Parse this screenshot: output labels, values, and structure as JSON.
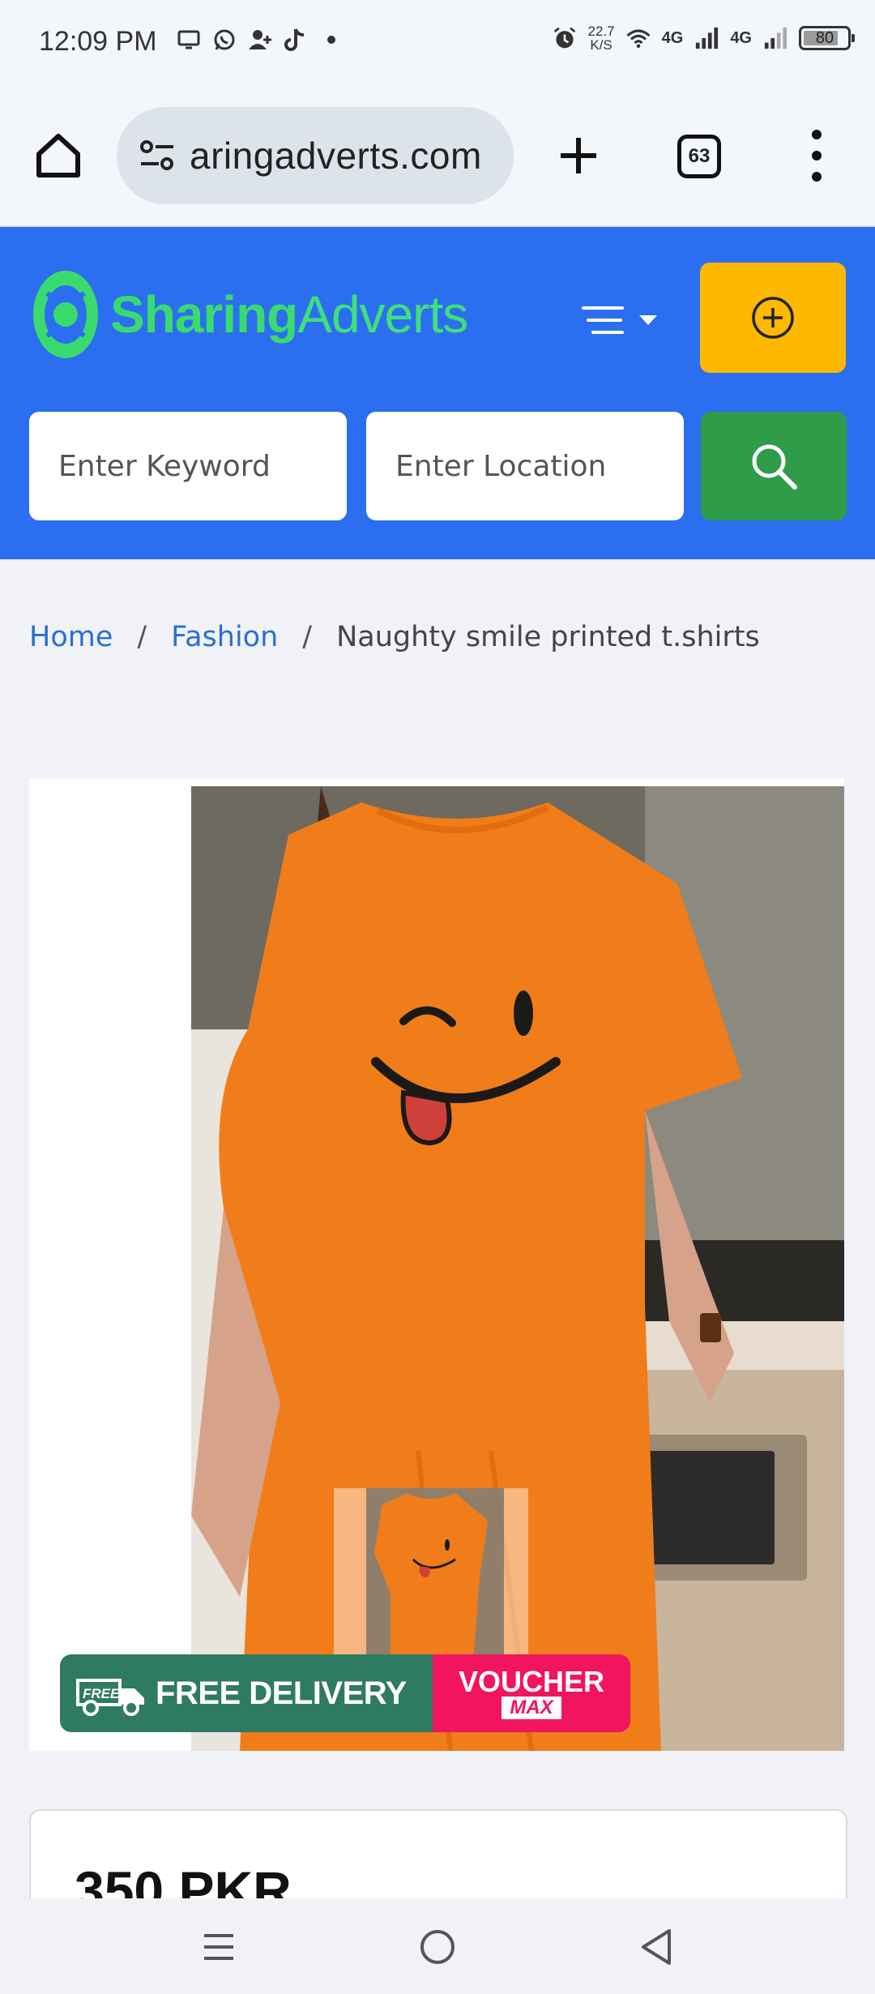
{
  "status_bar": {
    "time": "12:09 PM",
    "speed_value": "22.7",
    "speed_unit": "K/S",
    "network_1": "4G",
    "network_2": "4G",
    "battery": "80",
    "battery_level_percent": 80,
    "icons": [
      "screen-icon",
      "whatsapp-icon",
      "contact-add-icon",
      "tiktok-icon",
      "dot-icon",
      "alarm-icon",
      "wifi-icon",
      "signal-icon",
      "signal-icon",
      "battery-icon"
    ]
  },
  "browser": {
    "url": "aringadverts.com",
    "tab_count": "63",
    "icons": [
      "home-icon",
      "site-settings-icon",
      "plus-icon",
      "tabs-icon",
      "more-vert-icon"
    ]
  },
  "header": {
    "logo_bold": "Sharing",
    "logo_light": "Adverts",
    "brand_color": "#2b6ff0",
    "logo_color": "#3adb6e",
    "post_ad_color": "#ffb800",
    "search": {
      "keyword_placeholder": "Enter Keyword",
      "location_placeholder": "Enter Location",
      "button_color": "#2e9c48"
    }
  },
  "breadcrumb": {
    "items": [
      {
        "label": "Home"
      },
      {
        "label": "Fashion"
      }
    ],
    "separator": "/",
    "current": "Naughty smile printed t.shirts"
  },
  "gallery": {
    "promo_left": "FREE DELIVERY",
    "promo_truck_label": "FREE",
    "promo_right": "VOUCHER",
    "promo_right_sub": "MAX"
  },
  "product": {
    "price": "350 PKR"
  }
}
